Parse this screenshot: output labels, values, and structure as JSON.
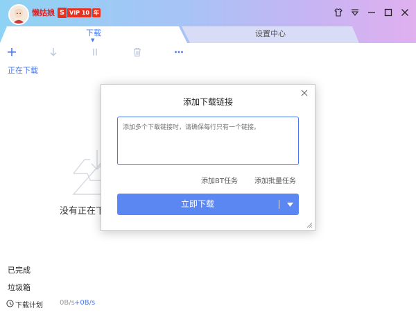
{
  "user": {
    "name": "懒姑娘",
    "vip_letter": "S",
    "vip_label": "VIP 10",
    "vip_year": "年"
  },
  "tabs": [
    {
      "label": "下载",
      "active": true
    },
    {
      "label": "设置中心",
      "active": false
    }
  ],
  "window_controls": [
    "skin-icon",
    "menu-icon",
    "minimize-icon",
    "maximize-icon",
    "close-icon"
  ],
  "toolbar": [
    "add-icon",
    "download-arrow-icon",
    "pause-icon",
    "delete-icon",
    "more-icon"
  ],
  "sidebar": {
    "downloading": "正在下载",
    "completed": "已完成",
    "trash": "垃圾箱"
  },
  "empty_state": {
    "text": "没有正在下载的任务"
  },
  "statusbar": {
    "plan": "下载计划",
    "down_speed": "0B/s",
    "up_speed": "+0B/s"
  },
  "dialog": {
    "title": "添加下载链接",
    "placeholder": "添加多个下载链接时，请确保每行只有一个链接。",
    "link_bt": "添加BT任务",
    "link_batch": "添加批量任务",
    "primary": "立即下载"
  },
  "colors": {
    "accent": "#4a78ea",
    "primary_button": "#5b87f3",
    "username": "#d6262b",
    "vip_badge": "#e8321f"
  }
}
